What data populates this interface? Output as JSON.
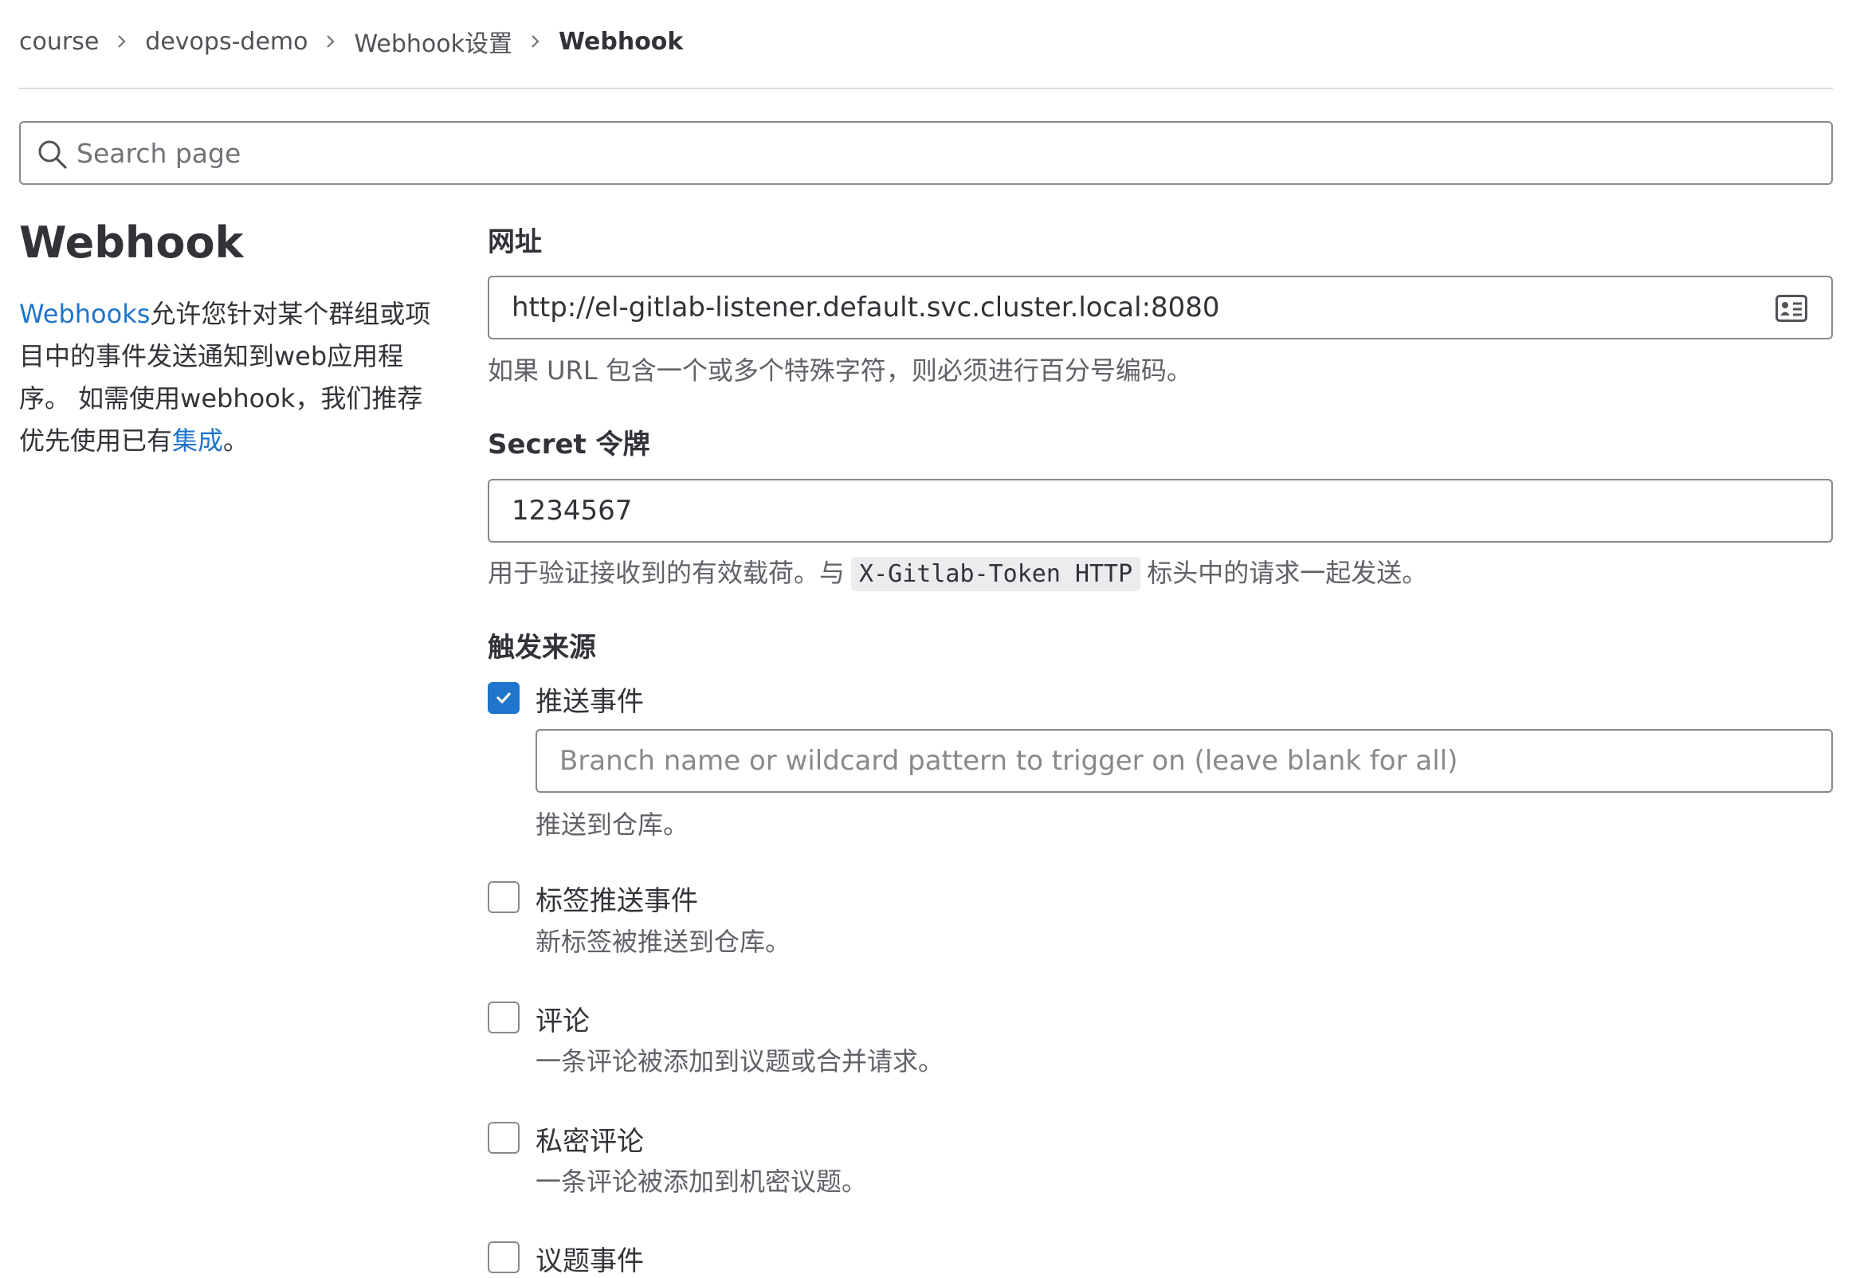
{
  "breadcrumb": {
    "items": [
      "course",
      "devops-demo",
      "Webhook设置"
    ],
    "current": "Webhook"
  },
  "search": {
    "placeholder": "Search page",
    "icon": "search-icon"
  },
  "sidebar": {
    "title": "Webhook",
    "desc_link": "Webhooks",
    "desc_text": "允许您针对某个群组或项目中的事件发送通知到web应用程序。 如需使用webhook，我们推荐优先使用已有",
    "desc_link2": "集成",
    "desc_end": "。"
  },
  "url_field": {
    "label": "网址",
    "value": "http://el-gitlab-listener.default.svc.cluster.local:8080",
    "help": "如果 URL 包含一个或多个特殊字符，则必须进行百分号编码。",
    "icon": "address-card-icon"
  },
  "secret_field": {
    "label": "Secret 令牌",
    "value": "1234567",
    "help_before": "用于验证接收到的有效载荷。与",
    "help_code": "X-Gitlab-Token HTTP",
    "help_after": "标头中的请求一起发送。"
  },
  "triggers": {
    "title": "触发来源",
    "push": {
      "label": "推送事件",
      "checked": true,
      "branch_placeholder": "Branch name or wildcard pattern to trigger on (leave blank for all)",
      "help": "推送到仓库。"
    },
    "tag_push": {
      "label": "标签推送事件",
      "checked": false,
      "help": "新标签被推送到仓库。"
    },
    "comments": {
      "label": "评论",
      "checked": false,
      "help": "一条评论被添加到议题或合并请求。"
    },
    "confidential_comments": {
      "label": "私密评论",
      "checked": false,
      "help": "一条评论被添加到机密议题。"
    },
    "issues": {
      "label": "议题事件",
      "checked": false
    }
  },
  "colors": {
    "accent": "#1f75cb",
    "border": "#89888d",
    "text": "#333238",
    "muted": "#626168"
  }
}
